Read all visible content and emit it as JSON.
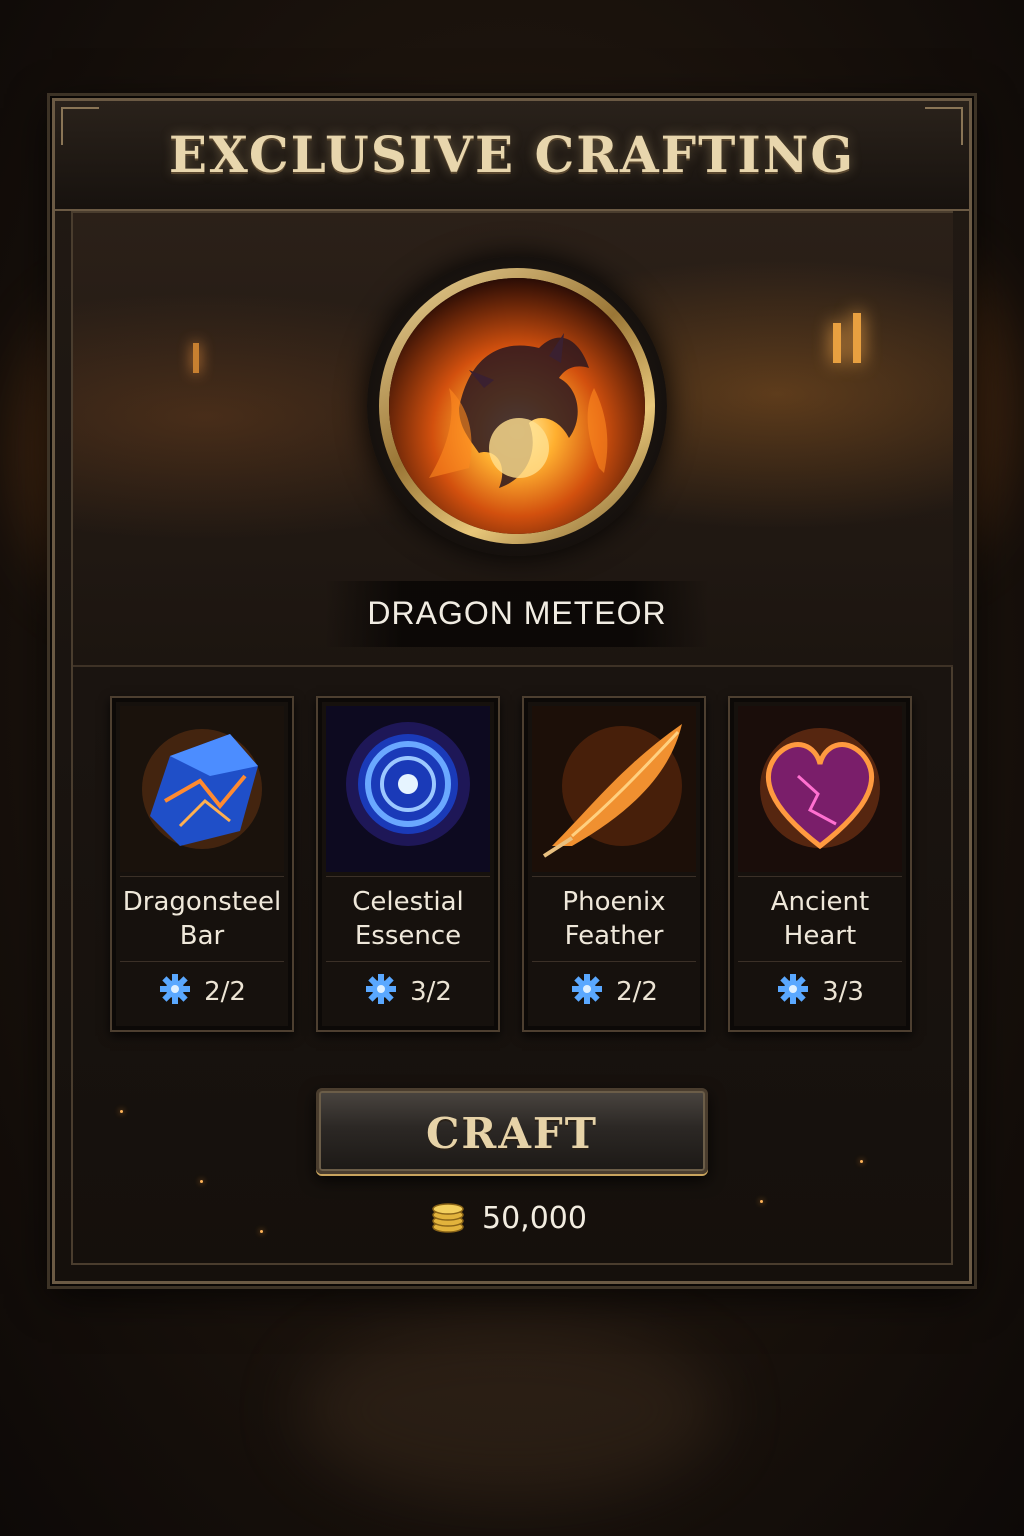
{
  "header": {
    "title": "EXCLUSIVE CRAFTING"
  },
  "result": {
    "name": "DRAGON METEOR",
    "icon": "dragon-fire-icon"
  },
  "materials": [
    {
      "name": "Dragonsteel\nBar",
      "owned_required": "2/2",
      "icon": "dragonsteel-crystal-icon"
    },
    {
      "name": "Celestial\nEssence",
      "owned_required": "3/2",
      "icon": "celestial-orb-icon"
    },
    {
      "name": "Phoenix\nFeather",
      "owned_required": "2/2",
      "icon": "phoenix-feather-icon"
    },
    {
      "name": "Ancient\nHeart",
      "owned_required": "3/3",
      "icon": "ancient-heart-icon"
    }
  ],
  "craft": {
    "label": "CRAFT",
    "cost": "50,000",
    "currency_icon": "gold-coins-icon"
  },
  "colors": {
    "gold": "#e8d6ad",
    "frame": "#6b5a44",
    "gear_blue": "#5aa8ff"
  }
}
